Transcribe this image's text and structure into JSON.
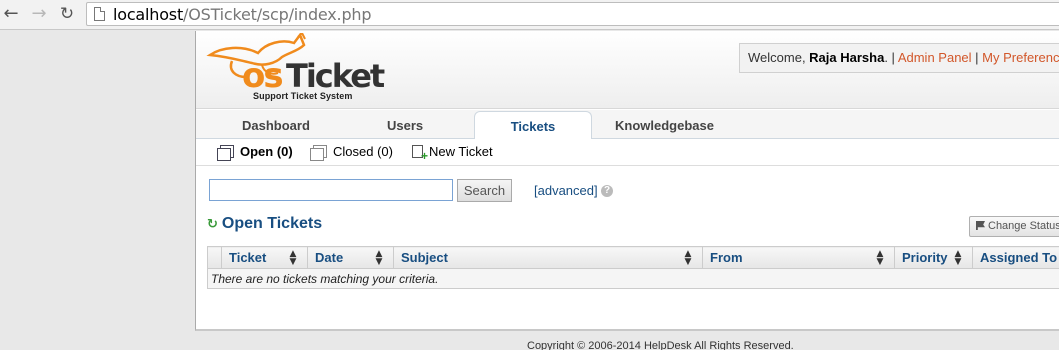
{
  "browser": {
    "url_host": "localhost",
    "url_path": "/OSTicket/scp/index.php"
  },
  "header": {
    "logo_text": "osTicket",
    "logo_subtitle": "Support Ticket System",
    "welcome_prefix": "Welcome, ",
    "user_name": "Raja Harsha",
    "welcome_suffix": ". | ",
    "admin_panel": "Admin Panel",
    "separator": " | ",
    "preferences": "My Preferences"
  },
  "tabs": [
    {
      "label": "Dashboard"
    },
    {
      "label": "Users"
    },
    {
      "label": "Tickets",
      "active": true
    },
    {
      "label": "Knowledgebase"
    }
  ],
  "subnav": {
    "open": "Open (0)",
    "closed": "Closed (0)",
    "new_ticket": "New Ticket"
  },
  "search": {
    "value": "",
    "button": "Search",
    "advanced": "[advanced]",
    "help": "?"
  },
  "section": {
    "title": "Open Tickets",
    "change_status": "Change Status"
  },
  "table": {
    "columns": [
      "Ticket",
      "Date",
      "Subject",
      "From",
      "Priority",
      "Assigned To"
    ],
    "empty_message": "There are no tickets matching your criteria."
  },
  "footer": {
    "text": "Copyright © 2006-2014 HelpDesk All Rights Reserved."
  },
  "colors": {
    "brand_orange": "#f08b1d",
    "link_blue": "#184e81",
    "link_orange": "#d2572a"
  }
}
